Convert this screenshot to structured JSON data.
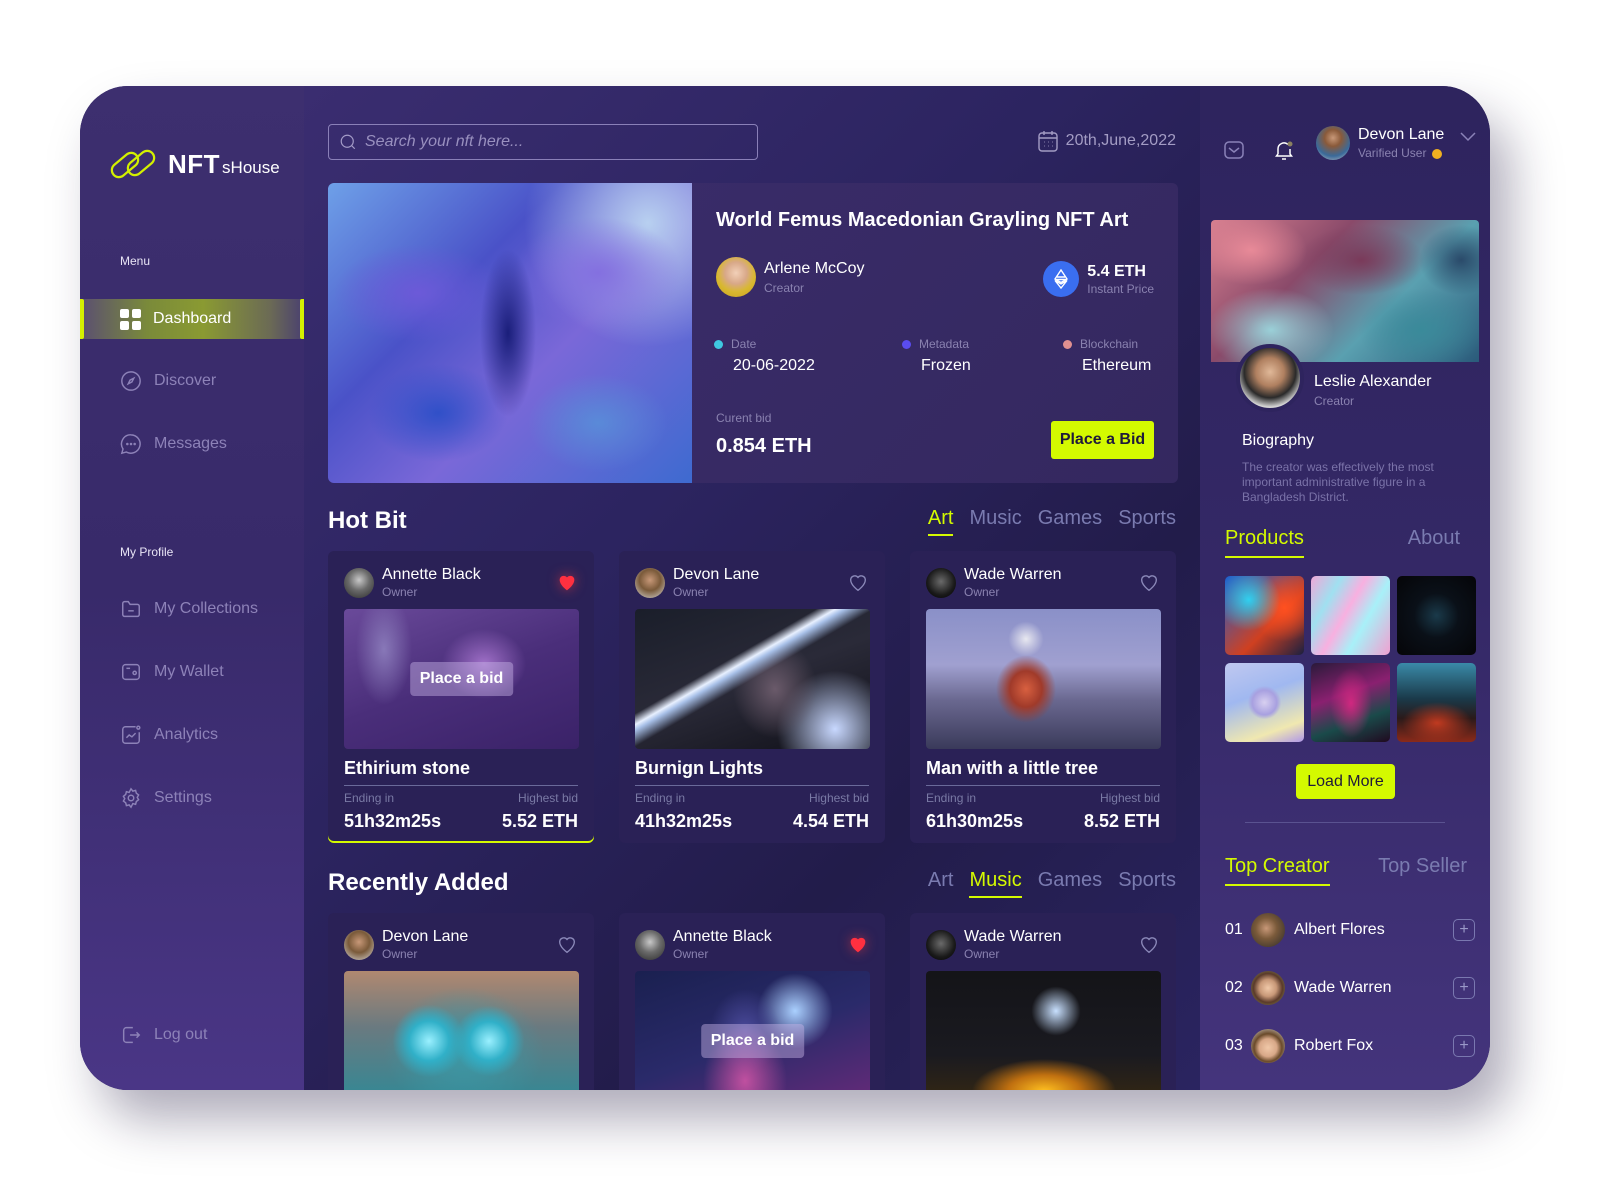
{
  "brand": {
    "logo_main": "NFT",
    "logo_sub": "sHouse"
  },
  "sidebar": {
    "menu_label": "Menu",
    "menu_items": [
      {
        "label": "Dashboard",
        "icon": "grid-icon",
        "active": true
      },
      {
        "label": "Discover",
        "icon": "compass-icon"
      },
      {
        "label": "Messages",
        "icon": "chat-icon"
      }
    ],
    "profile_label": "My Profile",
    "profile_items": [
      {
        "label": "My Collections",
        "icon": "folder-icon"
      },
      {
        "label": "My Wallet",
        "icon": "wallet-icon"
      },
      {
        "label": "Analytics",
        "icon": "analytics-icon"
      },
      {
        "label": "Settings",
        "icon": "gear-icon"
      }
    ],
    "logout_label": "Log out"
  },
  "header": {
    "search_placeholder": "Search your nft here...",
    "date": "20th,June,2022"
  },
  "featured": {
    "title": "World Femus Macedonian Grayling NFT Art",
    "creator_name": "Arlene McCoy",
    "creator_role": "Creator",
    "instant_price": "5.4 ETH",
    "instant_price_label": "Instant Price",
    "meta": [
      {
        "label": "Date",
        "value": "20-06-2022",
        "color": "#3fc8e0"
      },
      {
        "label": "Metadata",
        "value": "Frozen",
        "color": "#5a4cf0"
      },
      {
        "label": "Blockchain",
        "value": "Ethereum",
        "color": "#e09090"
      }
    ],
    "current_bid_label": "Curent bid",
    "current_bid": "0.854 ETH",
    "place_bid_label": "Place a Bid"
  },
  "hot_bit": {
    "title": "Hot Bit",
    "tabs": [
      "Art",
      "Music",
      "Games",
      "Sports"
    ],
    "active_tab": "Art",
    "cards": [
      {
        "owner": "Annette Black",
        "owner_role": "Owner",
        "liked": true,
        "title": "Ethirium stone",
        "ending_label": "Ending in",
        "ending": "51h32m25s",
        "bid_label": "Highest bid",
        "bid": "5.52 ETH",
        "overlay": "Place a bid"
      },
      {
        "owner": "Devon Lane",
        "owner_role": "Owner",
        "liked": false,
        "title": "Burnign Lights",
        "ending_label": "Ending in",
        "ending": "41h32m25s",
        "bid_label": "Highest bid",
        "bid": "4.54 ETH"
      },
      {
        "owner": "Wade Warren",
        "owner_role": "Owner",
        "liked": false,
        "title": "Man with a little tree",
        "ending_label": "Ending in",
        "ending": "61h30m25s",
        "bid_label": "Highest bid",
        "bid": "8.52 ETH"
      }
    ]
  },
  "recently_added": {
    "title": "Recently Added",
    "tabs": [
      "Art",
      "Music",
      "Games",
      "Sports"
    ],
    "active_tab": "Music",
    "cards": [
      {
        "owner": "Devon Lane",
        "owner_role": "Owner",
        "liked": false
      },
      {
        "owner": "Annette Black",
        "owner_role": "Owner",
        "liked": true,
        "overlay": "Place a bid"
      },
      {
        "owner": "Wade Warren",
        "owner_role": "Owner",
        "liked": false
      }
    ]
  },
  "user": {
    "name": "Devon Lane",
    "status": "Varified User"
  },
  "profile": {
    "name": "Leslie Alexander",
    "role": "Creator",
    "bio_title": "Biography",
    "bio": "The creator was effectively the most important administrative figure in a Bangladesh District.",
    "tabs": [
      "Products",
      "About"
    ],
    "active_tab": "Products",
    "load_more_label": "Load More"
  },
  "ranking": {
    "tabs": [
      "Top Creator",
      "Top Seller"
    ],
    "active_tab": "Top Creator",
    "creators": [
      {
        "rank": "01",
        "name": "Albert Flores"
      },
      {
        "rank": "02",
        "name": "Wade Warren"
      },
      {
        "rank": "03",
        "name": "Robert Fox"
      }
    ]
  },
  "colors": {
    "accent": "#d4fa00",
    "like": "#ff3040",
    "eth": "#3a6ef0"
  }
}
